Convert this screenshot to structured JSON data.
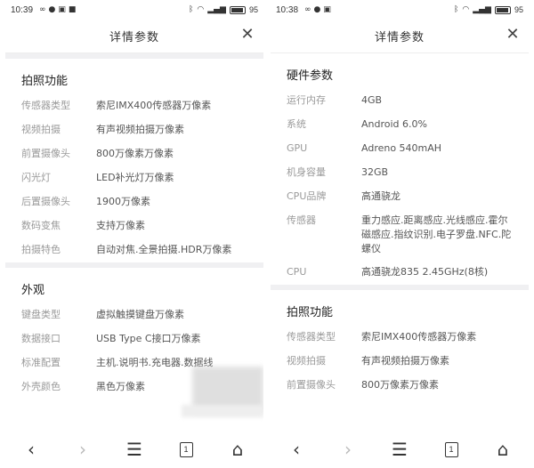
{
  "left": {
    "status": {
      "time": "10:39",
      "battery": "95"
    },
    "header": {
      "title": "详情参数"
    },
    "sections": [
      {
        "title": "拍照功能",
        "rows": [
          {
            "k": "传感器类型",
            "v": "索尼IMX400传感器万像素"
          },
          {
            "k": "视频拍摄",
            "v": "有声视频拍摄万像素"
          },
          {
            "k": "前置摄像头",
            "v": "800万像素万像素"
          },
          {
            "k": "闪光灯",
            "v": "LED补光灯万像素"
          },
          {
            "k": "后置摄像头",
            "v": "1900万像素"
          },
          {
            "k": "数码变焦",
            "v": "支持万像素"
          },
          {
            "k": "拍摄特色",
            "v": "自动对焦.全景拍摄.HDR万像素"
          }
        ]
      },
      {
        "title": "外观",
        "rows": [
          {
            "k": "键盘类型",
            "v": "虚拟触摸键盘万像素"
          },
          {
            "k": "数据接口",
            "v": "USB Type C接口万像素"
          },
          {
            "k": "标准配置",
            "v": "主机.说明书.充电器.数据线"
          },
          {
            "k": "外壳颜色",
            "v": "黑色万像素"
          }
        ]
      }
    ],
    "nav": {
      "page": "1"
    }
  },
  "right": {
    "status": {
      "time": "10:38",
      "battery": "95"
    },
    "header": {
      "title": "详情参数"
    },
    "sections": [
      {
        "title": "硬件参数",
        "rows": [
          {
            "k": "运行内存",
            "v": "4GB"
          },
          {
            "k": "系统",
            "v": "Android 6.0%"
          },
          {
            "k": "GPU",
            "v": "Adreno 540mAH"
          },
          {
            "k": "机身容量",
            "v": "32GB"
          },
          {
            "k": "CPU品牌",
            "v": "高通骁龙"
          },
          {
            "k": "传感器",
            "v": "重力感应.距离感应.光线感应.霍尔磁感应.指纹识别.电子罗盘.NFC.陀螺仪"
          },
          {
            "k": "CPU",
            "v": "高通骁龙835 2.45GHz(8核)"
          }
        ]
      },
      {
        "title": "拍照功能",
        "rows": [
          {
            "k": "传感器类型",
            "v": "索尼IMX400传感器万像素"
          },
          {
            "k": "视频拍摄",
            "v": "有声视频拍摄万像素"
          },
          {
            "k": "前置摄像头",
            "v": "800万像素万像素"
          }
        ]
      }
    ],
    "nav": {
      "page": "1"
    }
  }
}
